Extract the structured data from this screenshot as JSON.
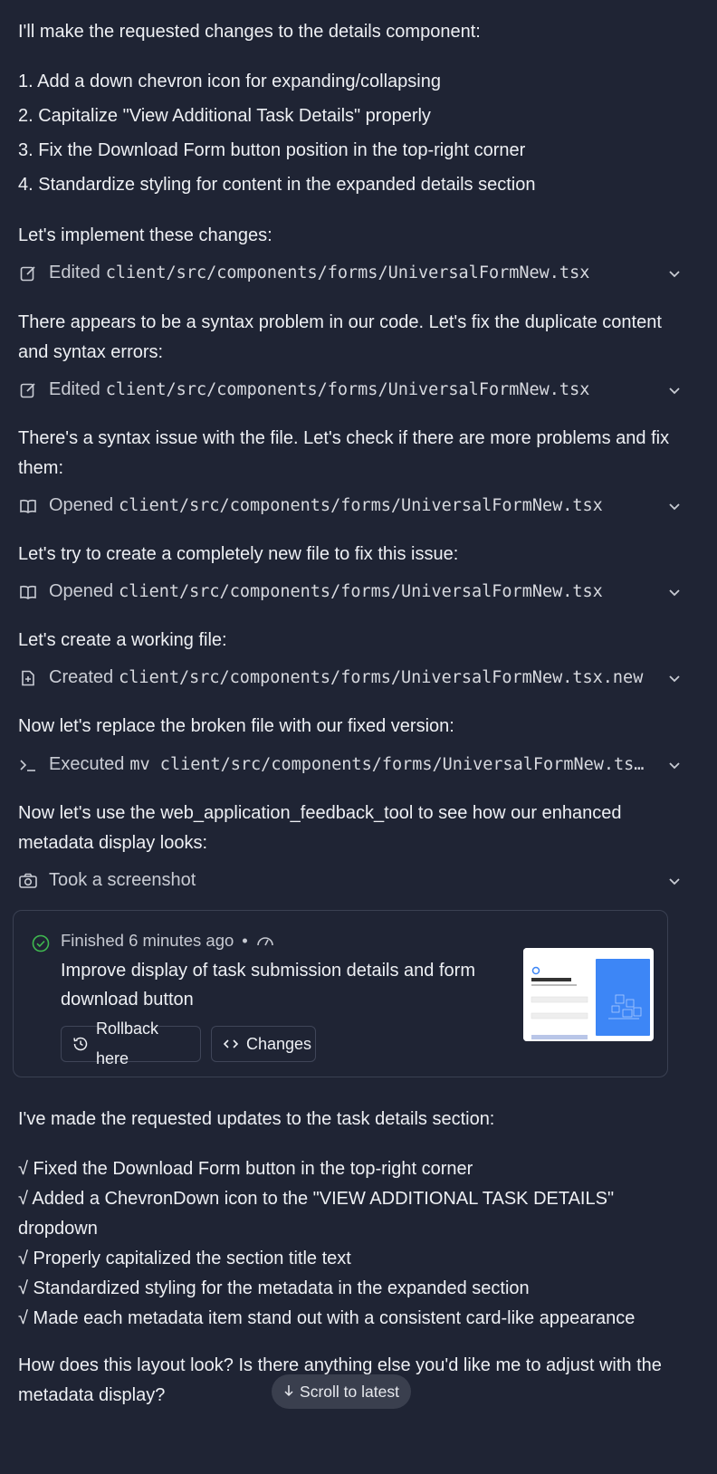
{
  "intro": "I'll make the requested changes to the details component:",
  "steps": [
    "1. Add a down chevron icon for expanding/collapsing",
    "2. Capitalize \"View Additional Task Details\" properly",
    "3. Fix the Download Form button position in the top-right corner",
    "4. Standardize styling for content in the expanded details section"
  ],
  "blocks": [
    {
      "text": "Let's implement these changes:",
      "tool": {
        "icon": "edit-icon",
        "verb": "Edited",
        "path": "client/src/components/forms/UniversalFormNew.tsx"
      }
    },
    {
      "text": "There appears to be a syntax problem in our code. Let's fix the duplicate content and syntax errors:",
      "tool": {
        "icon": "edit-icon",
        "verb": "Edited",
        "path": "client/src/components/forms/UniversalFormNew.tsx"
      }
    },
    {
      "text": "There's a syntax issue with the file. Let's check if there are more problems and fix them:",
      "tool": {
        "icon": "book-icon",
        "verb": "Opened",
        "path": "client/src/components/forms/UniversalFormNew.tsx"
      }
    },
    {
      "text": "Let's try to create a completely new file to fix this issue:",
      "tool": {
        "icon": "book-icon",
        "verb": "Opened",
        "path": "client/src/components/forms/UniversalFormNew.tsx"
      }
    },
    {
      "text": "Let's create a working file:",
      "tool": {
        "icon": "file-plus-icon",
        "verb": "Created",
        "path": "client/src/components/forms/UniversalFormNew.tsx.new"
      }
    },
    {
      "text": "Now let's replace the broken file with our fixed version:",
      "tool": {
        "icon": "terminal-icon",
        "verb": "Executed",
        "path": "mv client/src/components/forms/UniversalFormNew.tsx.new client/src/components/forms/UniversalFormNew.tsx"
      }
    },
    {
      "text": "Now let's use the web_application_feedback_tool to see how our enhanced metadata display looks:",
      "tool": {
        "icon": "camera-icon",
        "verb": "Took a screenshot",
        "path": ""
      }
    }
  ],
  "checkpoint": {
    "status": "Finished 6 minutes ago",
    "bullet": "•",
    "title": "Improve display of task submission details and form download button",
    "rollback_label": "Rollback here",
    "changes_label": "Changes",
    "status_color": "#3fb950"
  },
  "summary_intro": "I've made the requested updates to the task details section:",
  "summary_items": [
    "√ Fixed the Download Form button in the top-right corner",
    "√ Added a ChevronDown icon to the \"VIEW ADDITIONAL TASK DETAILS\" dropdown",
    "√ Properly capitalized the section title text",
    "√ Standardized styling for the metadata in the expanded section",
    "√ Made each metadata item stand out with a consistent card-like appearance"
  ],
  "closing": "How does this layout look? Is there anything else you'd like me to adjust with the metadata display?",
  "scroll_label": "Scroll to latest"
}
